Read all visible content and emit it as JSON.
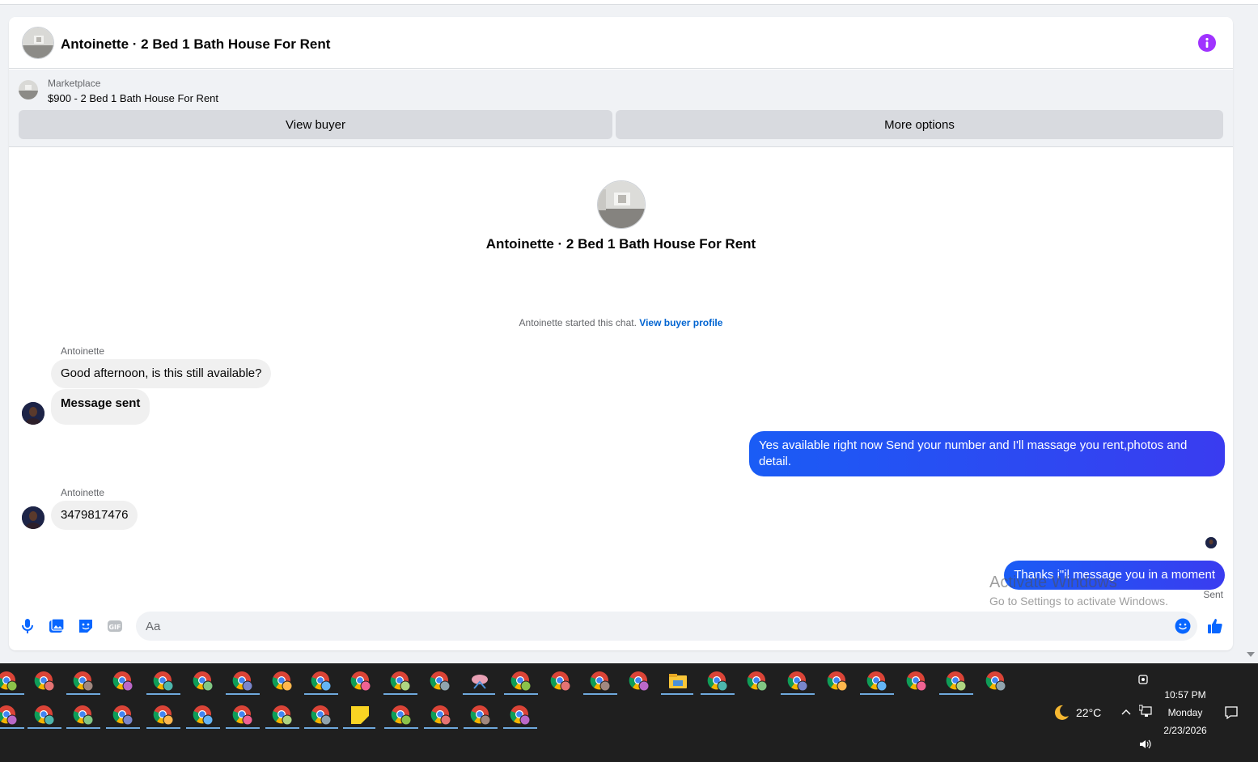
{
  "header": {
    "title": "Antoinette · 2 Bed 1 Bath House For Rent"
  },
  "listing": {
    "kind": "Marketplace",
    "price_title": "$900 - 2 Bed 1 Bath House For Rent",
    "view_buyer_label": "View buyer",
    "more_options_label": "More options"
  },
  "intro": {
    "title": "Antoinette · 2 Bed 1 Bath House For Rent",
    "started_text": "Antoinette started this chat. ",
    "buyer_profile_link": "View buyer profile"
  },
  "messages": {
    "sender1": "Antoinette",
    "msg1": "Good afternoon, is this still available?",
    "msg2": "Message sent",
    "reply1": "Yes available right now Send your number and I'll massage you rent,photos and detail.",
    "sender2": "Antoinette",
    "msg3": "3479817476",
    "reply2": "Thanks i\"il message you in a moment",
    "status": "Sent"
  },
  "watermark": {
    "line1": "Activate Windows",
    "line2": "Go to Settings to activate Windows."
  },
  "composer": {
    "placeholder": "Aa"
  },
  "taskbar": {
    "weather": "22°C",
    "time": "10:57 PM",
    "day": "Monday",
    "date": "2/23/2026"
  },
  "colors": {
    "accent_purple": "#a033ff",
    "link_blue": "#0064d1",
    "outgoing_bubble": "#2b4cf2",
    "icon_blue": "#0866ff"
  }
}
